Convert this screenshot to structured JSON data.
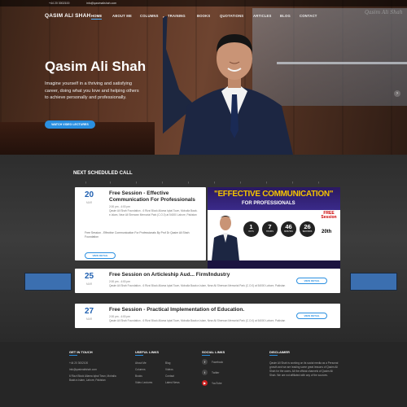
{
  "topbar": {
    "phone": "+44 20 3002100",
    "email": "info@qasimalishah.com"
  },
  "nav": {
    "logo": "QASIM ALI SHAH",
    "items": [
      "HOME",
      "ABOUT ME",
      "COLUMNS",
      "TRAINING",
      "BOOKS",
      "QUOTATIONS",
      "ARTICLES",
      "BLOG",
      "CONTACT"
    ],
    "signature": "Qasim Ali Shah"
  },
  "hero": {
    "title": "Qasim Ali Shah",
    "text": "Imagine yourself in a thriving and satisfying career, doing what you love and helping others to achieve personally and professionally.",
    "button": "WATCH VIDEO LECTURES"
  },
  "schedule": {
    "title": "NEXT SCHEDULED CALL",
    "ticks": [
      "|",
      "|",
      "|",
      "|",
      "|",
      "|",
      "|",
      "|",
      "|",
      "|"
    ],
    "events": [
      {
        "day": "20",
        "month": "MAR",
        "title": "Free Session - Effective Communication For Professionals",
        "time": "2:00 pm - 4:00 pm",
        "location": "Qasim Ali Shah Foundation - 6 Rizzi Block Allama Iqbal Town, Mohalla Baab-e-Islam, Near Ali Sherwan Memorial Park (C.O.0) at 54000 Lahore, Pakistan",
        "desc": "Free Session - Effective Communication For Professionals By Prof Dr Qasim Ali Shah Foundation",
        "more": "VIEW DETAIL"
      },
      {
        "day": "25",
        "month": "MAR",
        "title": "Free Session on Articleship Aud... Firm/Industry",
        "time": "2:00 pm - 4:00 pm",
        "location": "Qasim Ali Shah Foundation - 6 Rizzi Block Allama Iqbal Town, Mohalla Baab-e-Islam, Near Ali Sherwan Memorial Park (C.O.0) at 54000 Lahore, Pakistan",
        "more": "VIEW DETAIL"
      },
      {
        "day": "27",
        "month": "MAR",
        "title": "Free Session - Practical Implementation of Education.",
        "time": "2:00 pm - 4:00 pm",
        "location": "Qasim Ali Shah Foundation - 6 Rizzi Block Allama Iqbal Town, Mohalla Baab-e-Islam, Near Ali Sherwan Memorial Park (C.O.0) at 54000 Lahore, Pakistan",
        "more": "VIEW DETAIL"
      }
    ],
    "poster": {
      "line1": "\"EFFECTIVE COMMUNICATION\"",
      "line2": "FOR PROFESSIONALS",
      "countdown": [
        {
          "n": "1",
          "u": "DAYS"
        },
        {
          "n": "7",
          "u": "HOURS"
        },
        {
          "n": "46",
          "u": "MINUTES"
        },
        {
          "n": "26",
          "u": "SECONDS"
        }
      ],
      "free": "FREE Session",
      "date": "20th"
    }
  },
  "footer": {
    "get_in_touch": {
      "title": "GET IN TOUCH",
      "lines": [
        "+44 20 3002100",
        "info@qasimalishah.com",
        "6 Rizzi Block Allama Iqbal Town, Mohalla Baab-e-Islam, Lahore, Pakistan"
      ]
    },
    "useful_links": {
      "title": "USEFUL LINKS",
      "col1": [
        "About Me",
        "Columns",
        "Books",
        "Video Lectures"
      ],
      "col2": [
        "Blog",
        "Videos",
        "Contact",
        "Latest News"
      ]
    },
    "social_links": {
      "title": "SOCIAL LINKS",
      "items": [
        "Facebook",
        "Twitter",
        "YouTube"
      ]
    },
    "disclaimer": {
      "title": "DISCLAIMER",
      "text": "Qasim Ali Shah is working on its social media as a Personal growth and we are leading some great lessons of Qasim Ali Shah for the users. All the official channels of Qasim Ali Shah. We are not affiliated with any of the sources."
    }
  }
}
